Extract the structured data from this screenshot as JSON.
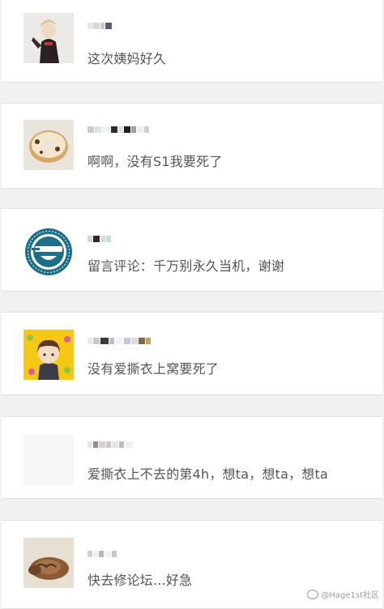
{
  "comments": [
    {
      "text": "这次姨妈好久"
    },
    {
      "text": "啊啊，没有S1我要死了"
    },
    {
      "text": "留言评论：千万别永久当机，谢谢"
    },
    {
      "text": "没有爱撕衣上窝要死了"
    },
    {
      "text": "爱撕衣上不去的第4h，想ta，想ta，想ta"
    },
    {
      "text": "快去修论坛...好急"
    }
  ],
  "watermark": {
    "text": "@Hage1st社区"
  },
  "colors": {
    "page_background": "#f1f1f1",
    "card_background": "#ffffff",
    "comment_text": "#555555",
    "divider": "#e2e2e2"
  },
  "avatars": [
    {
      "icon": "anime-character-avatar"
    },
    {
      "icon": "donut-avatar"
    },
    {
      "icon": "laughing-man-logo-avatar"
    },
    {
      "icon": "chibi-boy-avatar"
    },
    {
      "icon": "blank-avatar"
    },
    {
      "icon": "sleeping-cat-avatar"
    }
  ]
}
